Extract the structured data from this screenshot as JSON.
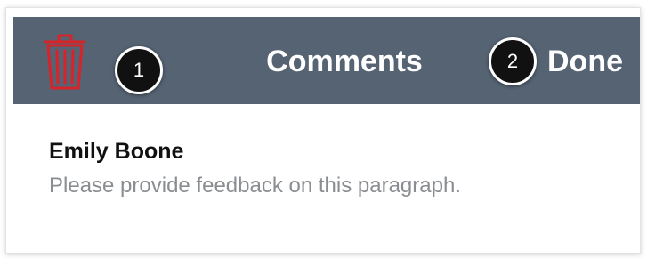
{
  "colors": {
    "header_bg": "#556373",
    "trash_icon": "#d8232a",
    "header_text": "#ffffff",
    "badge_bg": "#111111",
    "author_text": "#111111",
    "comment_text": "#8a8d91"
  },
  "header": {
    "delete_icon": "trash-icon",
    "title": "Comments",
    "done_label": "Done"
  },
  "callouts": [
    "1",
    "2"
  ],
  "comment": {
    "author": "Emily Boone",
    "text": "Please provide feedback on this paragraph."
  }
}
